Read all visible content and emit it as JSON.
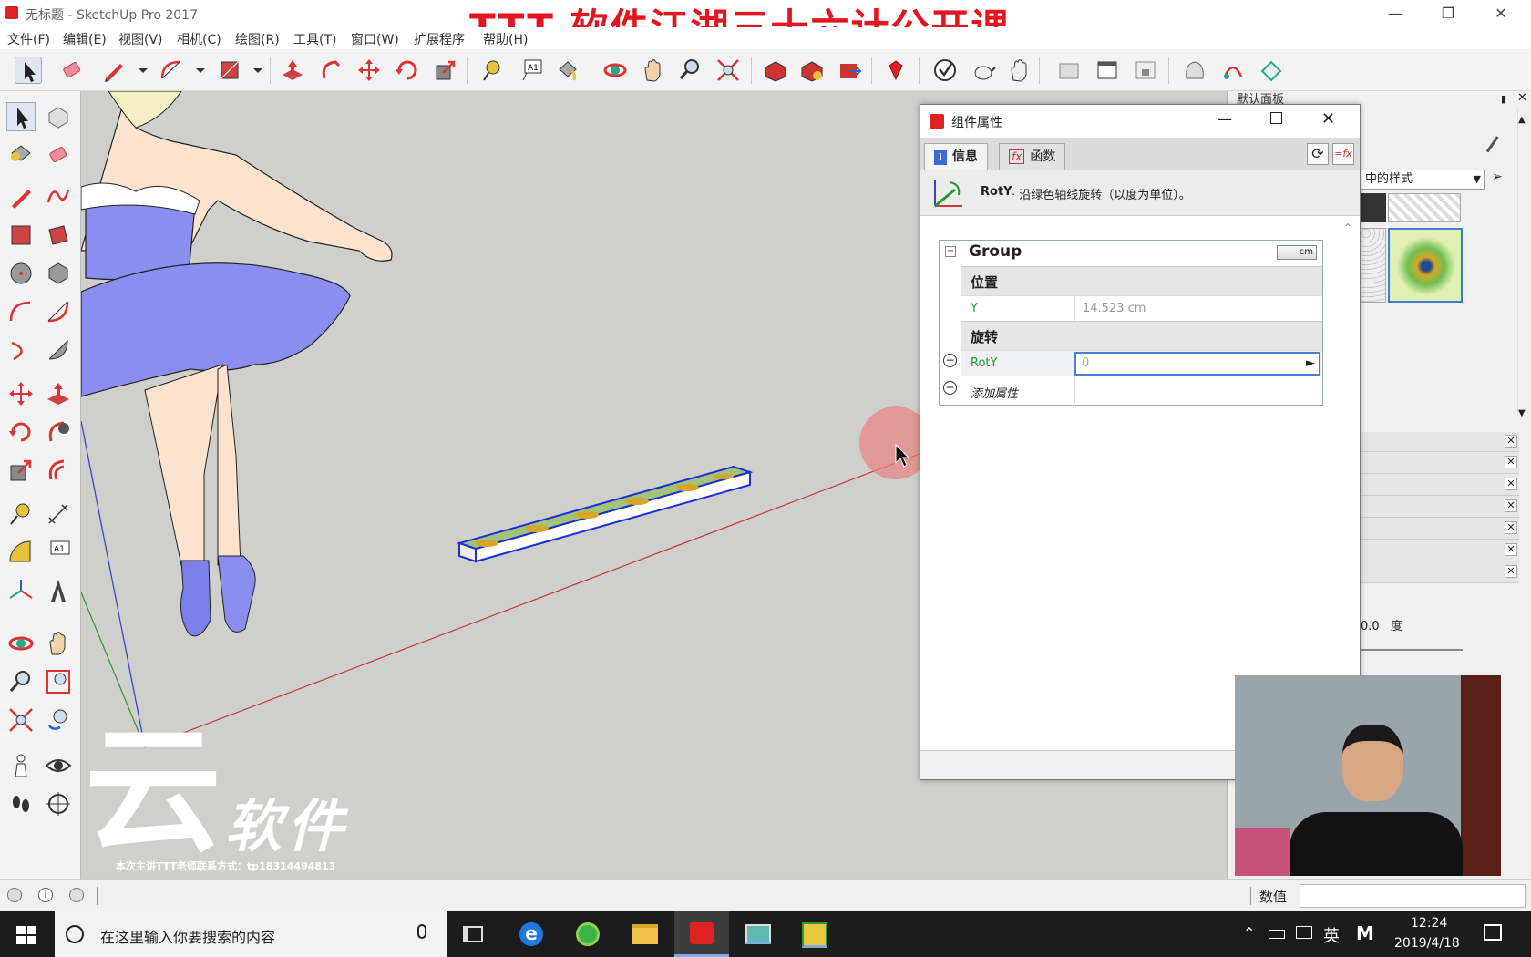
{
  "window": {
    "title": "无标题 - SketchUp Pro 2017",
    "overlay_title": "TTT  软件江湖三十六计公开课"
  },
  "menu": [
    "文件(F)",
    "编辑(E)",
    "视图(V)",
    "相机(C)",
    "绘图(R)",
    "工具(T)",
    "窗口(W)",
    "扩展程序",
    "帮助(H)"
  ],
  "dialog": {
    "title": "组件属性",
    "tabs": [
      "信息",
      "函数"
    ],
    "info_name": "RotY",
    "info_desc": " · 沿绿色轴线旋转（以度为单位）。",
    "group_name": "Group",
    "unit_badge": "cm",
    "section_position": "位置",
    "row_y_label": "Y",
    "row_y_value": "14.523 cm",
    "section_rotation": "旋转",
    "row_roty_label": "RotY",
    "row_roty_value": "0",
    "add_attribute": "添加属性"
  },
  "right_panel": {
    "header": "默认面板",
    "style_select": "中的样式",
    "degree_value": "0.0",
    "degree_unit": "度"
  },
  "status": {
    "value_label": "数值",
    "value_input": ""
  },
  "watermark": {
    "logo_char": "云",
    "brand": "软件",
    "contact": "本次主讲TTT老师联系方式：tp18314494813"
  },
  "taskbar": {
    "search_placeholder": "在这里输入你要搜索的内容",
    "lang": "英",
    "ime": "M",
    "time": "12:24",
    "date": "2019/4/18"
  },
  "colors": {
    "accent_red": "#e3161f",
    "dialog_field_green": "#1f9a2e",
    "selection_blue": "#1a2fd6",
    "axis_red": "#c43a3a",
    "viewport_bg": "#cfcfcc",
    "dress_purple": "#8b8df0"
  }
}
